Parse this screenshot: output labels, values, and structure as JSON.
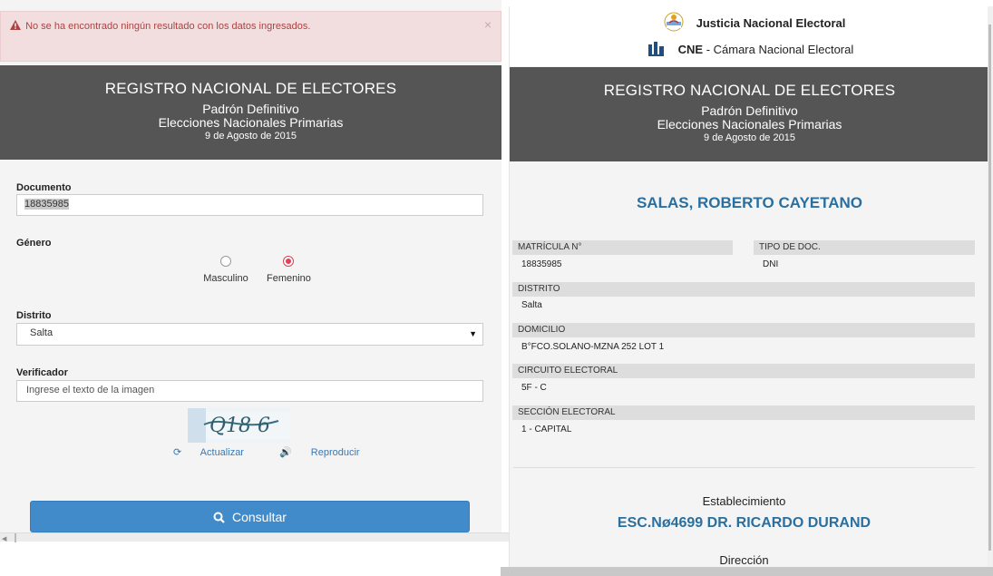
{
  "alert": {
    "message": "No se ha encontrado ningún resultado con los datos ingresados.",
    "close": "×"
  },
  "banner": {
    "title": "REGISTRO NACIONAL DE ELECTORES",
    "line1": "Padrón Definitivo",
    "line2": "Elecciones Nacionales Primarias",
    "date": "9 de Agosto de 2015"
  },
  "form": {
    "documento_label": "Documento",
    "documento_value": "18835985",
    "genero_label": "Género",
    "genero_options": [
      "Masculino",
      "Femenino"
    ],
    "genero_selected": "Femenino",
    "distrito_label": "Distrito",
    "distrito_value": "Salta",
    "verificador_label": "Verificador",
    "verificador_placeholder": "Ingrese el texto de la imagen",
    "captcha_text": "Q18 6",
    "actualizar": "Actualizar",
    "reproducir": "Reproducir",
    "consultar": "Consultar"
  },
  "header": {
    "jne": "Justicia Nacional Electoral",
    "cne_abbr": "CNE",
    "cne_name": " - Cámara Nacional Electoral"
  },
  "result": {
    "name": "SALAS, ROBERTO CAYETANO",
    "matricula_label": "MATRÍCULA N°",
    "matricula_value": "18835985",
    "tipo_label": "TIPO DE DOC.",
    "tipo_value": "DNI",
    "distrito_label": "DISTRITO",
    "distrito_value": "Salta",
    "domicilio_label": "DOMICILIO",
    "domicilio_value": "B°FCO.SOLANO-MZNA 252 LOT 1",
    "circuito_label": "CIRCUITO ELECTORAL",
    "circuito_value": "5F - C",
    "seccion_label": "SECCIÓN ELECTORAL",
    "seccion_value": "1 - CAPITAL",
    "establecimiento_label": "Establecimiento",
    "establecimiento_value": "ESC.Nø4699 DR. RICARDO DURAND",
    "direccion_label": "Dirección"
  },
  "colors": {
    "accent": "#2a6f9f",
    "button": "#428bca",
    "banner": "#555555",
    "alert_bg": "#f2dede",
    "radio_on": "#e0405a"
  },
  "icons": [
    "warning-icon",
    "close-icon",
    "refresh-icon",
    "volume-icon",
    "search-icon",
    "argentina-sun-icon",
    "cne-logo-icon"
  ]
}
